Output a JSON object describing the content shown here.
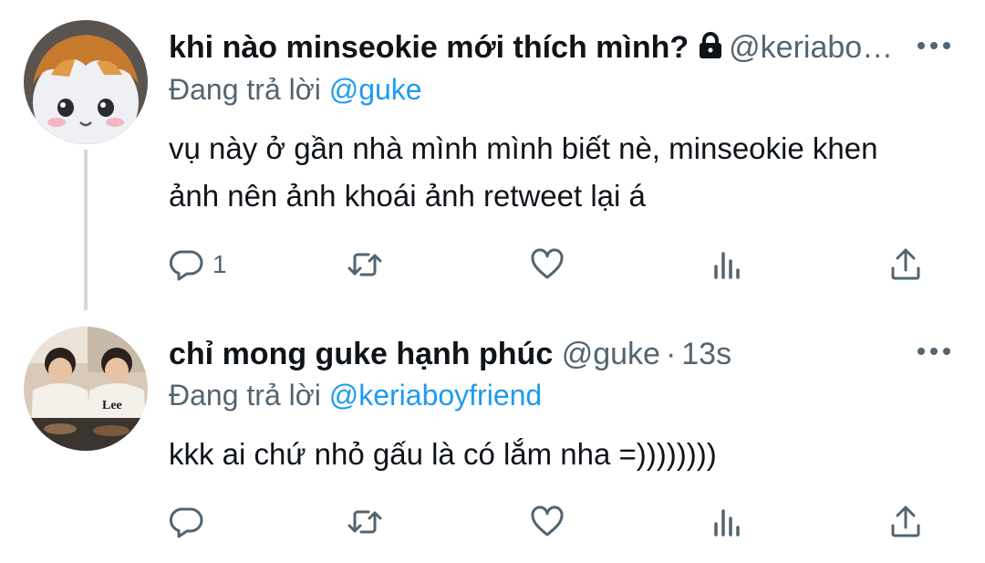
{
  "tweets": [
    {
      "display_name": "khi nào minseokie mới thích mình?",
      "protected_icon": "lock-icon",
      "handle": "@keriabo…",
      "time": "",
      "replying_prefix": "Đang trả lời",
      "replying_to": "@guke",
      "text_lines": [
        "vụ này ở gần nhà mình mình biết nè, minseokie khen",
        "ảnh nên ảnh khoái ảnh retweet lại á"
      ],
      "reply_count": "1",
      "retweet_count": "",
      "like_count": ""
    },
    {
      "display_name": "chỉ mong guke hạnh phúc",
      "handle": "@guke",
      "separator": "·",
      "time": "13s",
      "replying_prefix": "Đang trả lời",
      "replying_to": "@keriaboyfriend",
      "text_lines": [
        "kkk ai chứ nhỏ gấu là có lắm nha =))))))))"
      ],
      "reply_count": "",
      "retweet_count": "",
      "like_count": ""
    }
  ],
  "icons": [
    "more-icon",
    "reply-icon",
    "retweet-icon",
    "like-icon",
    "views-icon",
    "share-icon"
  ],
  "colors": {
    "text": "#0f1419",
    "secondary": "#536471",
    "link": "#1d9bf0",
    "thread_line": "#cfd9de"
  }
}
